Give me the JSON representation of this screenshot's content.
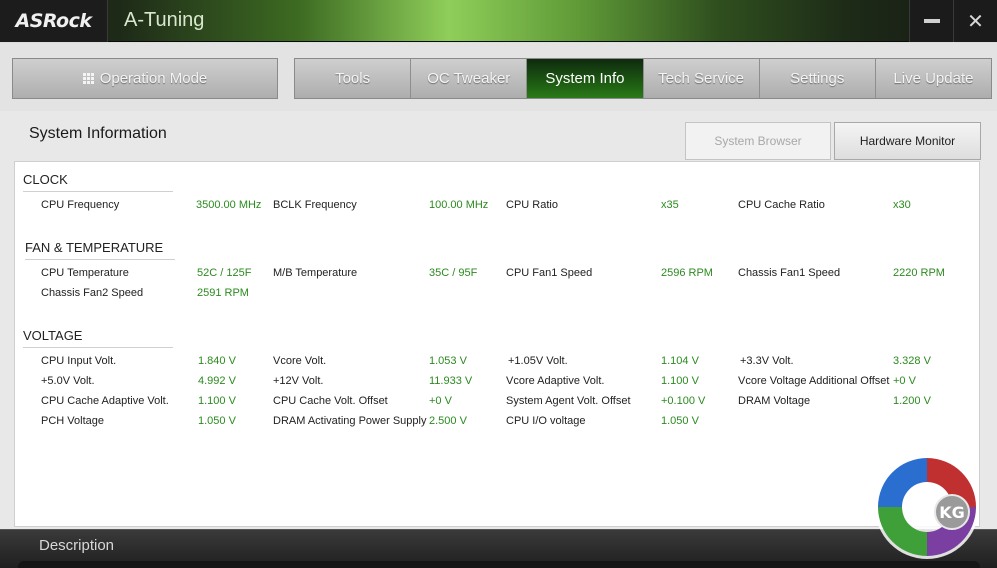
{
  "window": {
    "brand": "ASRock",
    "app_title": "A-Tuning",
    "minimize_label": "—",
    "close_label": "✕"
  },
  "nav": {
    "operation_mode": "Operation Mode",
    "tabs": [
      {
        "label": "Tools",
        "active": false
      },
      {
        "label": "OC Tweaker",
        "active": false
      },
      {
        "label": "System Info",
        "active": true
      },
      {
        "label": "Tech Service",
        "active": false
      },
      {
        "label": "Settings",
        "active": false
      },
      {
        "label": "Live Update",
        "active": false
      }
    ]
  },
  "content": {
    "title": "System Information",
    "system_browser": "System Browser",
    "hardware_monitor": "Hardware Monitor"
  },
  "sections": {
    "clock": {
      "title": "CLOCK",
      "items": [
        {
          "label": "CPU Frequency",
          "value": "3500.00 MHz"
        },
        {
          "label": "BCLK Frequency",
          "value": "100.00 MHz"
        },
        {
          "label": "CPU Ratio",
          "value": "x35"
        },
        {
          "label": "CPU Cache Ratio",
          "value": "x30"
        }
      ]
    },
    "fan": {
      "title": "FAN & TEMPERATURE",
      "items": [
        {
          "label": "CPU Temperature",
          "value": "52C / 125F"
        },
        {
          "label": "M/B Temperature",
          "value": "35C / 95F"
        },
        {
          "label": "CPU Fan1 Speed",
          "value": "2596 RPM"
        },
        {
          "label": "Chassis Fan1 Speed",
          "value": "2220 RPM"
        },
        {
          "label": "Chassis Fan2 Speed",
          "value": "2591 RPM"
        }
      ]
    },
    "voltage": {
      "title": "VOLTAGE",
      "items": [
        {
          "label": "CPU Input Volt.",
          "value": "1.840 V"
        },
        {
          "label": "Vcore Volt.",
          "value": "1.053 V"
        },
        {
          "label": "+1.05V Volt.",
          "value": "1.104 V"
        },
        {
          "label": "+3.3V Volt.",
          "value": "3.328 V"
        },
        {
          "label": "+5.0V Volt.",
          "value": "4.992 V"
        },
        {
          "label": "+12V Volt.",
          "value": "11.933 V"
        },
        {
          "label": "Vcore Adaptive Volt.",
          "value": "1.100 V"
        },
        {
          "label": "Vcore Voltage Additional Offset",
          "value": "+0 V"
        },
        {
          "label": "CPU Cache Adaptive Volt.",
          "value": "1.100 V"
        },
        {
          "label": "CPU Cache Volt. Offset",
          "value": "+0 V"
        },
        {
          "label": "System Agent Volt. Offset",
          "value": "+0.100 V"
        },
        {
          "label": "DRAM Voltage",
          "value": "1.200 V"
        },
        {
          "label": "PCH Voltage",
          "value": "1.050 V"
        },
        {
          "label": "DRAM Activating Power Supply",
          "value": "2.500 V"
        },
        {
          "label": "CPU I/O voltage",
          "value": "1.050 V"
        }
      ]
    }
  },
  "description": {
    "title": "Description"
  },
  "watermark": {
    "text": "KG"
  },
  "colors": {
    "accent_green": "#2b8a1f",
    "active_tab": "#1d5a12"
  }
}
